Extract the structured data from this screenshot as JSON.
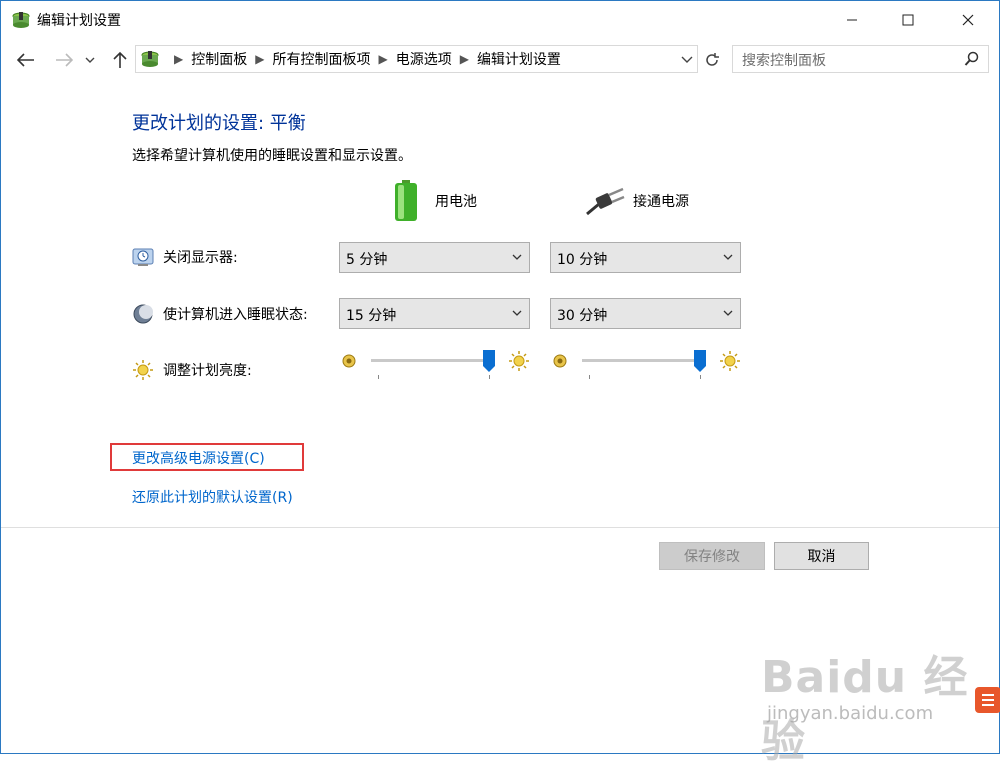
{
  "window": {
    "title": "编辑计划设置"
  },
  "breadcrumb": [
    "控制面板",
    "所有控制面板项",
    "电源选项",
    "编辑计划设置"
  ],
  "search": {
    "placeholder": "搜索控制面板"
  },
  "main": {
    "heading": "更改计划的设置: 平衡",
    "subtitle": "选择希望计算机使用的睡眠设置和显示设置。",
    "columns": {
      "battery": "用电池",
      "plugged": "接通电源"
    },
    "rows": {
      "display_off": {
        "label": "关闭显示器:",
        "battery": "5 分钟",
        "plugged": "10 分钟"
      },
      "sleep": {
        "label": "使计算机进入睡眠状态:",
        "battery": "15 分钟",
        "plugged": "30 分钟"
      },
      "brightness": {
        "label": "调整计划亮度:",
        "battery_level": 1.0,
        "plugged_level": 1.0
      }
    },
    "links": {
      "advanced": "更改高级电源设置(C)",
      "restore": "还原此计划的默认设置(R)"
    }
  },
  "buttons": {
    "save": "保存修改",
    "cancel": "取消"
  },
  "watermark": {
    "brand": "Baidu 经验",
    "url": "jingyan.baidu.com"
  },
  "colors": {
    "link": "#0066cc",
    "heading": "#003399",
    "highlight_border": "#e03a3a",
    "slider_thumb": "#0a6ed1"
  }
}
